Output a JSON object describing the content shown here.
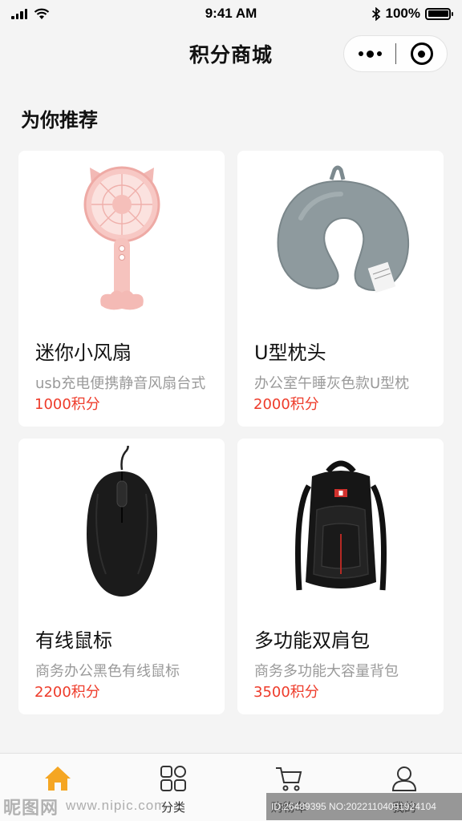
{
  "status_bar": {
    "time": "9:41 AM",
    "battery_text": "100%",
    "battery_level": 1.0,
    "icons": [
      "signal-icon",
      "wifi-icon",
      "bluetooth-icon",
      "battery-icon"
    ]
  },
  "nav": {
    "title": "积分商城",
    "capsule_icons": [
      "more-dots-icon",
      "target-close-icon"
    ]
  },
  "section": {
    "title": "为你推荐"
  },
  "products": [
    {
      "name": "迷你小风扇",
      "desc": "usb充电便携静音风扇台式",
      "price": "1000积分",
      "image": "pink-handheld-fan"
    },
    {
      "name": "U型枕头",
      "desc": "办公室午睡灰色款U型枕",
      "price": "2000积分",
      "image": "grey-u-pillow"
    },
    {
      "name": "有线鼠标",
      "desc": " 商务办公黑色有线鼠标",
      "price": "2200积分",
      "image": "black-wired-mouse"
    },
    {
      "name": "多功能双肩包",
      "desc": "商务多功能大容量背包",
      "price": "3500积分",
      "image": "black-backpack"
    }
  ],
  "tabs": [
    {
      "label": "首页",
      "icon": "home-icon",
      "active": true
    },
    {
      "label": "分类",
      "icon": "category-grid-icon",
      "active": false
    },
    {
      "label": "购物车",
      "icon": "cart-icon",
      "active": false
    },
    {
      "label": "我的",
      "icon": "user-icon",
      "active": false
    }
  ],
  "colors": {
    "accent": "#f5a623",
    "price": "#ee3b2a",
    "background": "#f4f4f4",
    "card": "#ffffff"
  },
  "watermark": {
    "logo": "昵图网",
    "url": "www.nipic.com",
    "id_text": "ID:26489395 NO:20221104091924104"
  }
}
